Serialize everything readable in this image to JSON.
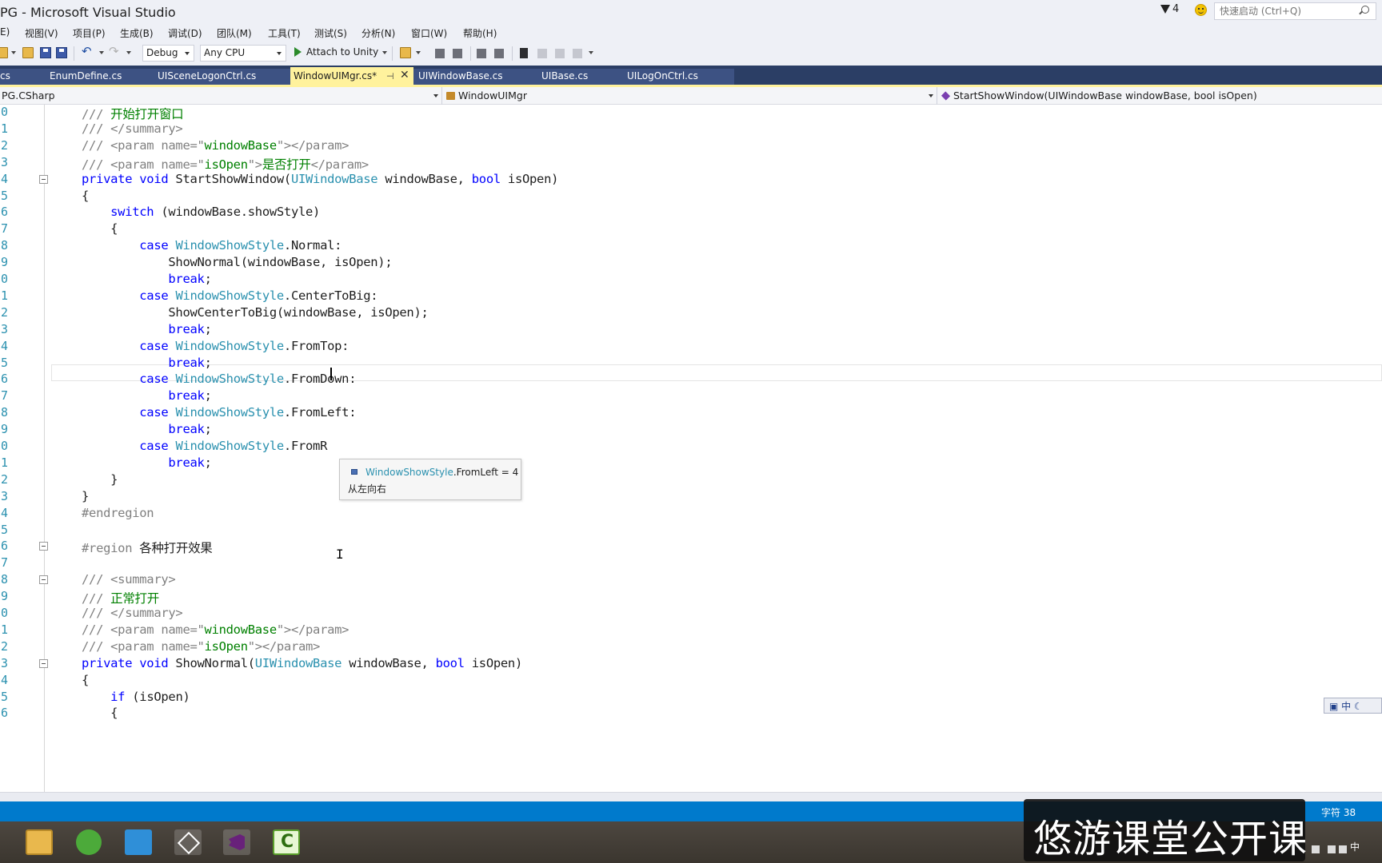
{
  "window": {
    "title": "PG - Microsoft Visual Studio",
    "notifications_count": "4",
    "quick_launch_placeholder": "快速启动 (Ctrl+Q)"
  },
  "menu": [
    "E)",
    "视图(V)",
    "项目(P)",
    "生成(B)",
    "调试(D)",
    "团队(M)",
    "工具(T)",
    "测试(S)",
    "分析(N)",
    "窗口(W)",
    "帮助(H)"
  ],
  "toolbar": {
    "configuration": "Debug",
    "platform": "Any CPU",
    "attach_label": "Attach to Unity"
  },
  "tabs": [
    "cs",
    "EnumDefine.cs",
    "UISceneLogonCtrl.cs",
    "WindowUIMgr.cs*",
    "UIWindowBase.cs",
    "UIBase.cs",
    "UILogOnCtrl.cs"
  ],
  "navbar": {
    "project": "PG.CSharp",
    "class": "WindowUIMgr",
    "member": "StartShowWindow(UIWindowBase windowBase, bool isOpen)"
  },
  "editor": {
    "line_numbers": [
      "0",
      "1",
      "2",
      "3",
      "4",
      "5",
      "6",
      "7",
      "8",
      "9",
      "0",
      "1",
      "2",
      "3",
      "4",
      "5",
      "6",
      "7",
      "8",
      "9",
      "0",
      "1",
      "2",
      "3",
      "4",
      "5",
      "6",
      "7",
      "8",
      "9",
      "0",
      "1",
      "2",
      "3",
      "4",
      "5",
      "6"
    ],
    "lines": [
      [
        {
          "t": "/// ",
          "c": "xd"
        },
        {
          "t": "开始打开窗口",
          "c": "cm"
        }
      ],
      [
        {
          "t": "/// </summary>",
          "c": "xd"
        }
      ],
      [
        {
          "t": "/// <param name=\"",
          "c": "xd"
        },
        {
          "t": "windowBase",
          "c": "cm"
        },
        {
          "t": "\"></param>",
          "c": "xd"
        }
      ],
      [
        {
          "t": "/// <param name=\"",
          "c": "xd"
        },
        {
          "t": "isOpen",
          "c": "cm"
        },
        {
          "t": "\">",
          "c": "xd"
        },
        {
          "t": "是否打开",
          "c": "cm"
        },
        {
          "t": "</param>",
          "c": "xd"
        }
      ],
      [
        {
          "t": "private void ",
          "c": "kw"
        },
        {
          "t": "StartShowWindow(",
          "c": ""
        },
        {
          "t": "UIWindowBase",
          "c": "ty"
        },
        {
          "t": " windowBase, ",
          "c": ""
        },
        {
          "t": "bool",
          "c": "kw"
        },
        {
          "t": " isOpen)",
          "c": ""
        }
      ],
      [
        {
          "t": "{",
          "c": ""
        }
      ],
      [
        {
          "t": "    "
        },
        {
          "t": "switch",
          "c": "kw"
        },
        {
          "t": " (windowBase.showStyle)",
          "c": ""
        }
      ],
      [
        {
          "t": "    {",
          "c": ""
        }
      ],
      [
        {
          "t": "        "
        },
        {
          "t": "case ",
          "c": "kw"
        },
        {
          "t": "WindowShowStyle",
          "c": "ty"
        },
        {
          "t": ".Normal:",
          "c": ""
        }
      ],
      [
        {
          "t": "            ShowNormal(windowBase, isOpen);",
          "c": ""
        }
      ],
      [
        {
          "t": "            "
        },
        {
          "t": "break",
          "c": "kw"
        },
        {
          "t": ";",
          "c": ""
        }
      ],
      [
        {
          "t": "        "
        },
        {
          "t": "case ",
          "c": "kw"
        },
        {
          "t": "WindowShowStyle",
          "c": "ty"
        },
        {
          "t": ".CenterToBig:",
          "c": ""
        }
      ],
      [
        {
          "t": "            ShowCenterToBig(windowBase, isOpen);",
          "c": ""
        }
      ],
      [
        {
          "t": "            "
        },
        {
          "t": "break",
          "c": "kw"
        },
        {
          "t": ";",
          "c": ""
        }
      ],
      [
        {
          "t": "        "
        },
        {
          "t": "case ",
          "c": "kw"
        },
        {
          "t": "WindowShowStyle",
          "c": "ty"
        },
        {
          "t": ".FromTop:",
          "c": ""
        }
      ],
      [
        {
          "t": "            "
        },
        {
          "t": "break",
          "c": "kw"
        },
        {
          "t": ";",
          "c": ""
        }
      ],
      [
        {
          "t": "        "
        },
        {
          "t": "case ",
          "c": "kw"
        },
        {
          "t": "WindowShowStyle",
          "c": "ty"
        },
        {
          "t": ".FromDown:",
          "c": ""
        }
      ],
      [
        {
          "t": "            "
        },
        {
          "t": "break",
          "c": "kw"
        },
        {
          "t": ";",
          "c": ""
        }
      ],
      [
        {
          "t": "        "
        },
        {
          "t": "case ",
          "c": "kw"
        },
        {
          "t": "WindowShowStyle",
          "c": "ty"
        },
        {
          "t": ".FromLeft:",
          "c": ""
        }
      ],
      [
        {
          "t": "            "
        },
        {
          "t": "break",
          "c": "kw"
        },
        {
          "t": ";",
          "c": ""
        }
      ],
      [
        {
          "t": "        "
        },
        {
          "t": "case ",
          "c": "kw"
        },
        {
          "t": "WindowShowStyle",
          "c": "ty"
        },
        {
          "t": ".FromR",
          "c": ""
        }
      ],
      [
        {
          "t": "            "
        },
        {
          "t": "break",
          "c": "kw"
        },
        {
          "t": ";",
          "c": ""
        }
      ],
      [
        {
          "t": "    }",
          "c": ""
        }
      ],
      [
        {
          "t": "}",
          "c": ""
        }
      ],
      [
        {
          "t": "#endregion",
          "c": "pp"
        }
      ],
      [],
      [
        {
          "t": "#region ",
          "c": "pp"
        },
        {
          "t": "各种打开效果",
          "c": ""
        }
      ],
      [],
      [
        {
          "t": "/// <summary>",
          "c": "xd"
        }
      ],
      [
        {
          "t": "/// ",
          "c": "xd"
        },
        {
          "t": "正常打开",
          "c": "cm"
        }
      ],
      [
        {
          "t": "/// </summary>",
          "c": "xd"
        }
      ],
      [
        {
          "t": "/// <param name=\"",
          "c": "xd"
        },
        {
          "t": "windowBase",
          "c": "cm"
        },
        {
          "t": "\"></param>",
          "c": "xd"
        }
      ],
      [
        {
          "t": "/// <param name=\"",
          "c": "xd"
        },
        {
          "t": "isOpen",
          "c": "cm"
        },
        {
          "t": "\"></param>",
          "c": "xd"
        }
      ],
      [
        {
          "t": "private void ",
          "c": "kw"
        },
        {
          "t": "ShowNormal(",
          "c": ""
        },
        {
          "t": "UIWindowBase",
          "c": "ty"
        },
        {
          "t": " windowBase, ",
          "c": ""
        },
        {
          "t": "bool",
          "c": "kw"
        },
        {
          "t": " isOpen)",
          "c": ""
        }
      ],
      [
        {
          "t": "{",
          "c": ""
        }
      ],
      [
        {
          "t": "    "
        },
        {
          "t": "if",
          "c": "kw"
        },
        {
          "t": " (isOpen)",
          "c": ""
        }
      ],
      [
        {
          "t": "    {",
          "c": ""
        }
      ]
    ],
    "fold_lines": [
      4,
      26,
      28,
      33
    ]
  },
  "tooltip": {
    "type": "WindowShowStyle",
    "member": ".FromLeft = 4",
    "description": "从左向右"
  },
  "ime": "中",
  "status": {
    "column": "字符 38"
  },
  "taskbar": {
    "tray_ime": "中"
  },
  "watermark": "悠游课堂公开课",
  "colors": {
    "status_bar": "#007acc",
    "active_tab": "#fff29d",
    "keyword": "#0000ff",
    "type": "#2b91af",
    "comment": "#008000"
  }
}
